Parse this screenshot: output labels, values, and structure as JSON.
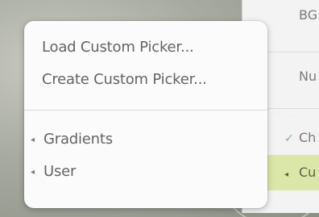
{
  "popup_menu": {
    "items": [
      {
        "label": "Load Custom Picker..."
      },
      {
        "label": "Create Custom Picker..."
      }
    ],
    "submenus": [
      {
        "label": "Gradients"
      },
      {
        "label": "User"
      }
    ]
  },
  "background_menu": {
    "items": [
      {
        "label": "BG"
      },
      {
        "label": "Nu"
      },
      {
        "label": "Ch",
        "checked": true
      },
      {
        "label": "Cu",
        "selected": true
      }
    ]
  },
  "colors": {
    "popup_bg": "#fbfbfb",
    "text": "#646464",
    "selected_bg": "#dbe7a8",
    "check": "#8aa7b8"
  },
  "icons": {
    "submenu_arrow": "left-triangle-icon",
    "checkmark": "check-icon"
  }
}
